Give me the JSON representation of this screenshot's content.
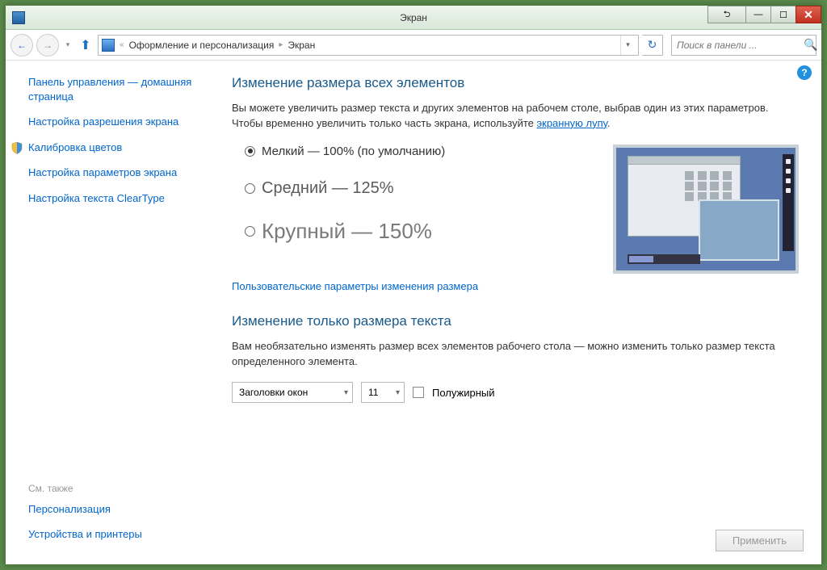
{
  "window": {
    "title": "Экран"
  },
  "breadcrumb": {
    "item1": "Оформление и персонализация",
    "item2": "Экран"
  },
  "search": {
    "placeholder": "Поиск в панели ..."
  },
  "sidebar": {
    "home": "Панель управления — домашняя страница",
    "resolution": "Настройка разрешения экрана",
    "calibration": "Калибровка цветов",
    "display_settings": "Настройка параметров экрана",
    "cleartype": "Настройка текста ClearType"
  },
  "footer": {
    "see_also": "См. также",
    "personalization": "Персонализация",
    "devices": "Устройства и принтеры"
  },
  "main": {
    "heading1": "Изменение размера всех элементов",
    "desc1_a": "Вы можете увеличить размер текста и других элементов на рабочем столе, выбрав один из этих параметров. Чтобы временно увеличить только часть экрана, используйте ",
    "desc1_link": "экранную лупу",
    "desc1_b": ".",
    "radio_small": "Мелкий — 100% (по умолчанию)",
    "radio_medium": "Средний — 125%",
    "radio_large": "Крупный — 150%",
    "custom_link": "Пользовательские параметры изменения размера",
    "heading2": "Изменение только размера текста",
    "desc2": "Вам необязательно изменять размер всех элементов рабочего стола — можно изменить только размер текста определенного элемента.",
    "select_element": "Заголовки окон",
    "select_size": "11",
    "bold_label": "Полужирный",
    "apply": "Применить"
  }
}
